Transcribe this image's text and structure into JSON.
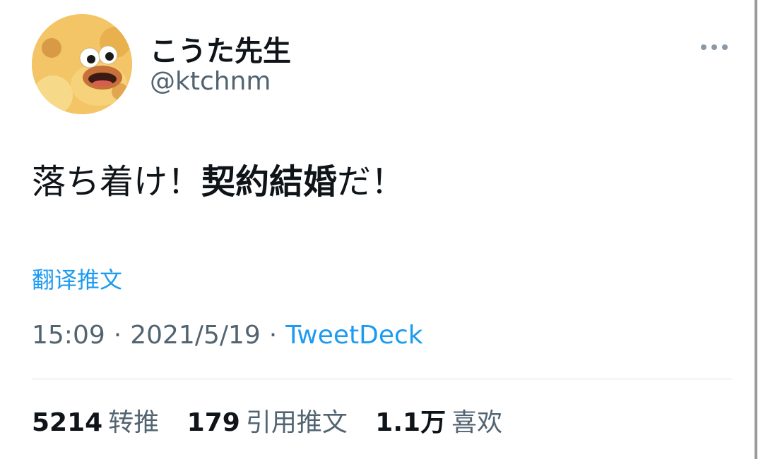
{
  "author": {
    "display_name": "こうた先生",
    "handle": "@ktchnm",
    "avatar_icon": "duck-avatar-icon"
  },
  "tweet": {
    "text_part1": "落ち着け！",
    "text_bold": "契約結婚",
    "text_part2": "だ！",
    "translate_label": "翻译推文"
  },
  "meta": {
    "time": "15:09",
    "separator": "·",
    "date": "2021/5/19",
    "source": "TweetDeck"
  },
  "stats": {
    "retweets_count": "5214",
    "retweets_label": "转推",
    "quotes_count": "179",
    "quotes_label": "引用推文",
    "likes_count": "1.1万",
    "likes_label": "喜欢"
  },
  "menu": {
    "more_icon": "more-horizontal-icon"
  },
  "colors": {
    "link": "#1d9bf0",
    "secondary_text": "#536471",
    "primary_text": "#0f1419"
  }
}
